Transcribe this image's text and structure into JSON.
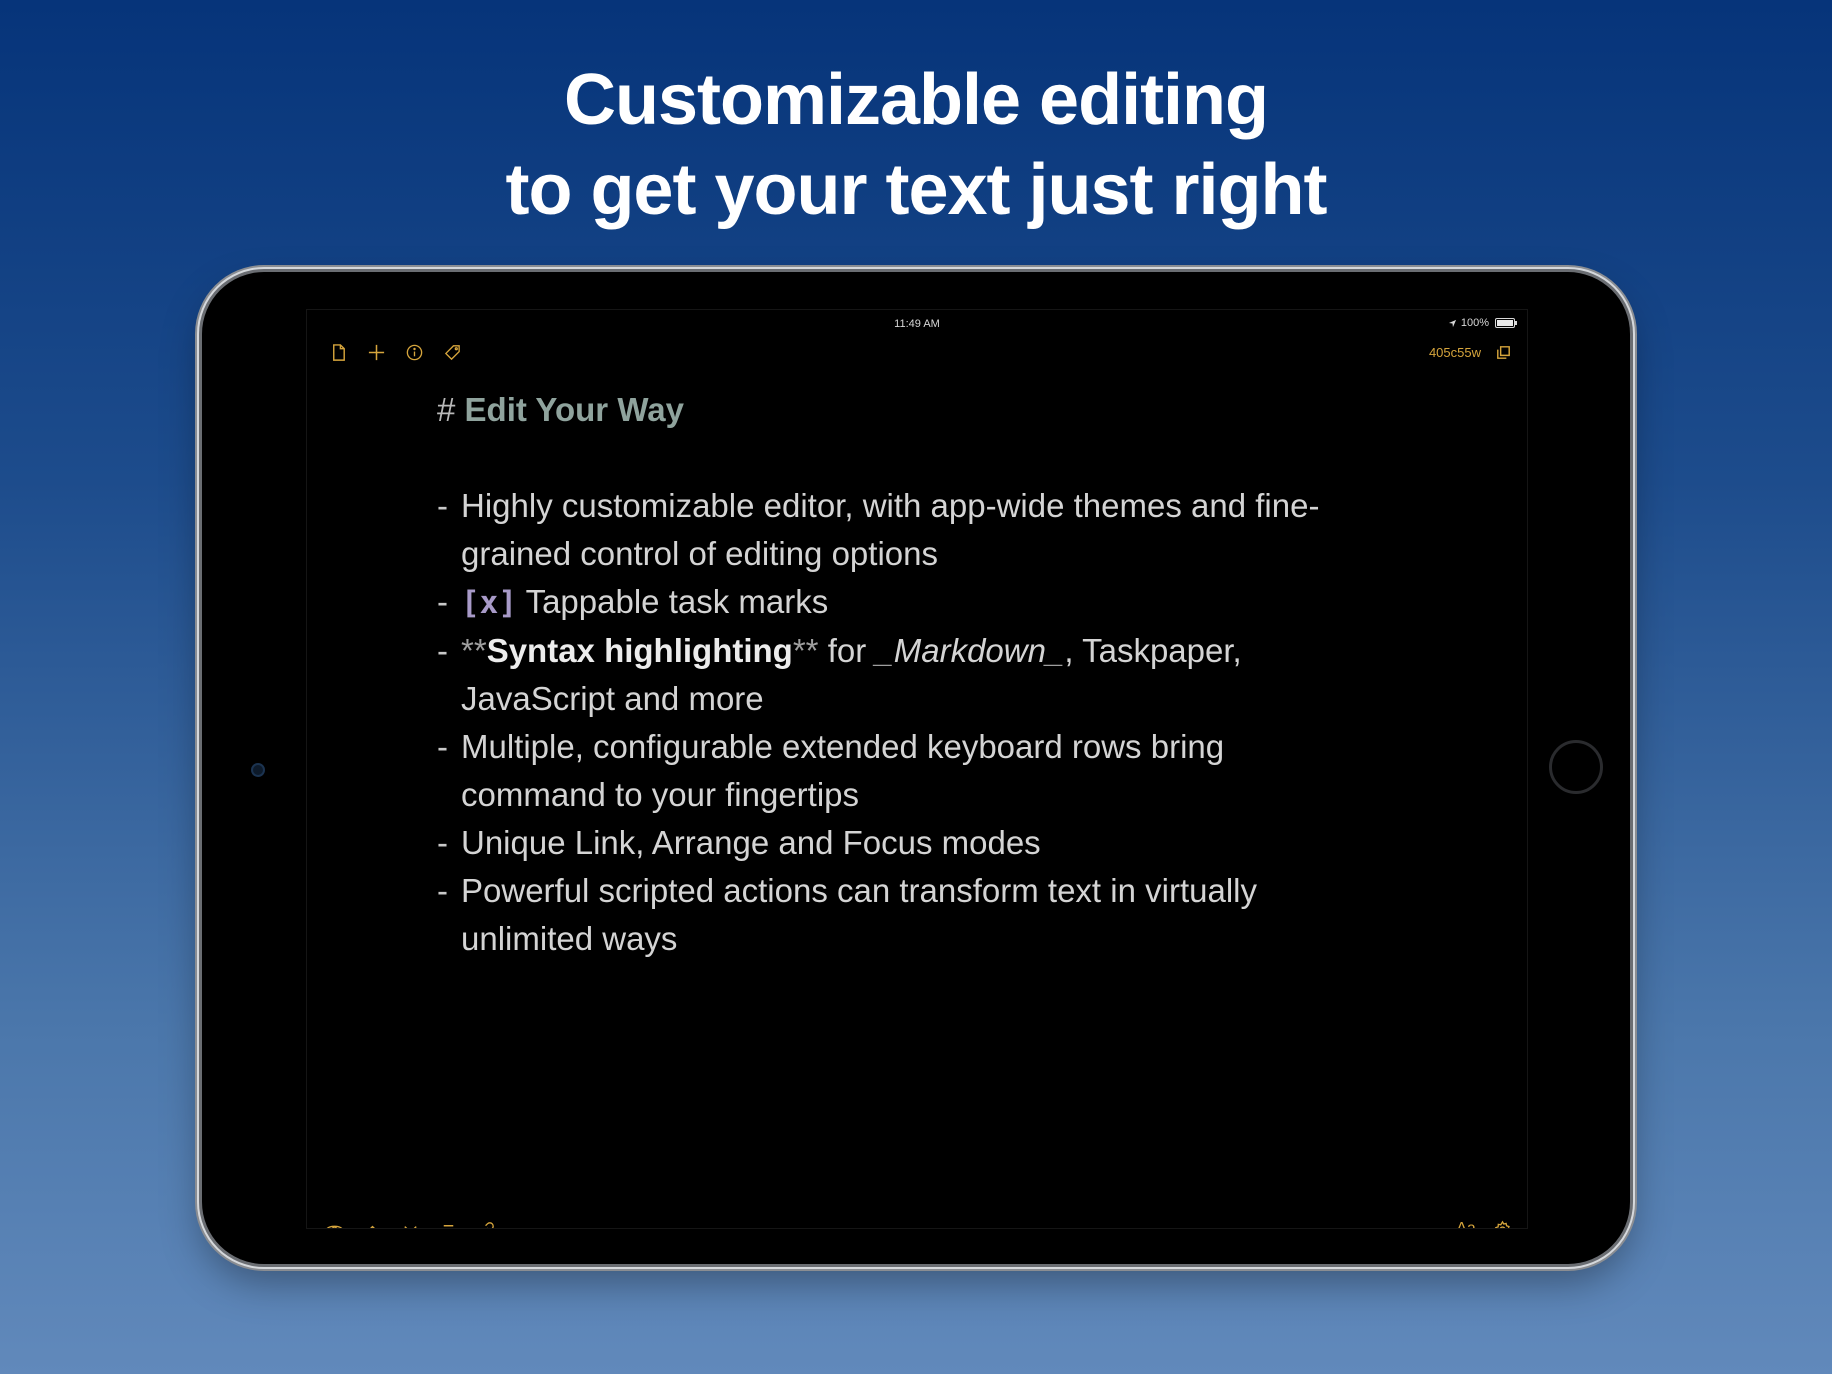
{
  "headline": {
    "line1": "Customizable editing",
    "line2": "to get your text just right"
  },
  "status_bar": {
    "time": "11:49 AM",
    "battery": "100%"
  },
  "toolbar": {
    "word_count": "405c55w"
  },
  "bottom_toolbar": {
    "font_label": "Aa"
  },
  "editor": {
    "heading_marker": "#",
    "heading_text": "Edit Your Way",
    "items": [
      {
        "line1": "Highly customizable editor, with app-wide themes and fine-",
        "line2": "grained control of editing options"
      },
      {
        "task_mark": "[x]",
        "text": "Tappable task marks"
      },
      {
        "bold_open": "**",
        "bold_text": "Syntax highlighting",
        "bold_close": "**",
        "mid_text": " for ",
        "italic_marker_open": "_",
        "italic_text": "Markdown",
        "italic_marker_close": "_",
        "tail_text": ", Taskpaper,",
        "line2": "JavaScript and more"
      },
      {
        "line1": "Multiple, configurable extended keyboard rows bring",
        "line2": "command to your fingertips"
      },
      {
        "line1": "Unique Link, Arrange and Focus modes"
      },
      {
        "line1": "Powerful scripted actions can transform text in virtually",
        "line2": "unlimited ways"
      }
    ]
  },
  "colors": {
    "accent": "#d6a53c",
    "heading": "#8fa39d",
    "task_mark": "#a89ac8",
    "text": "#d4d4d4"
  }
}
